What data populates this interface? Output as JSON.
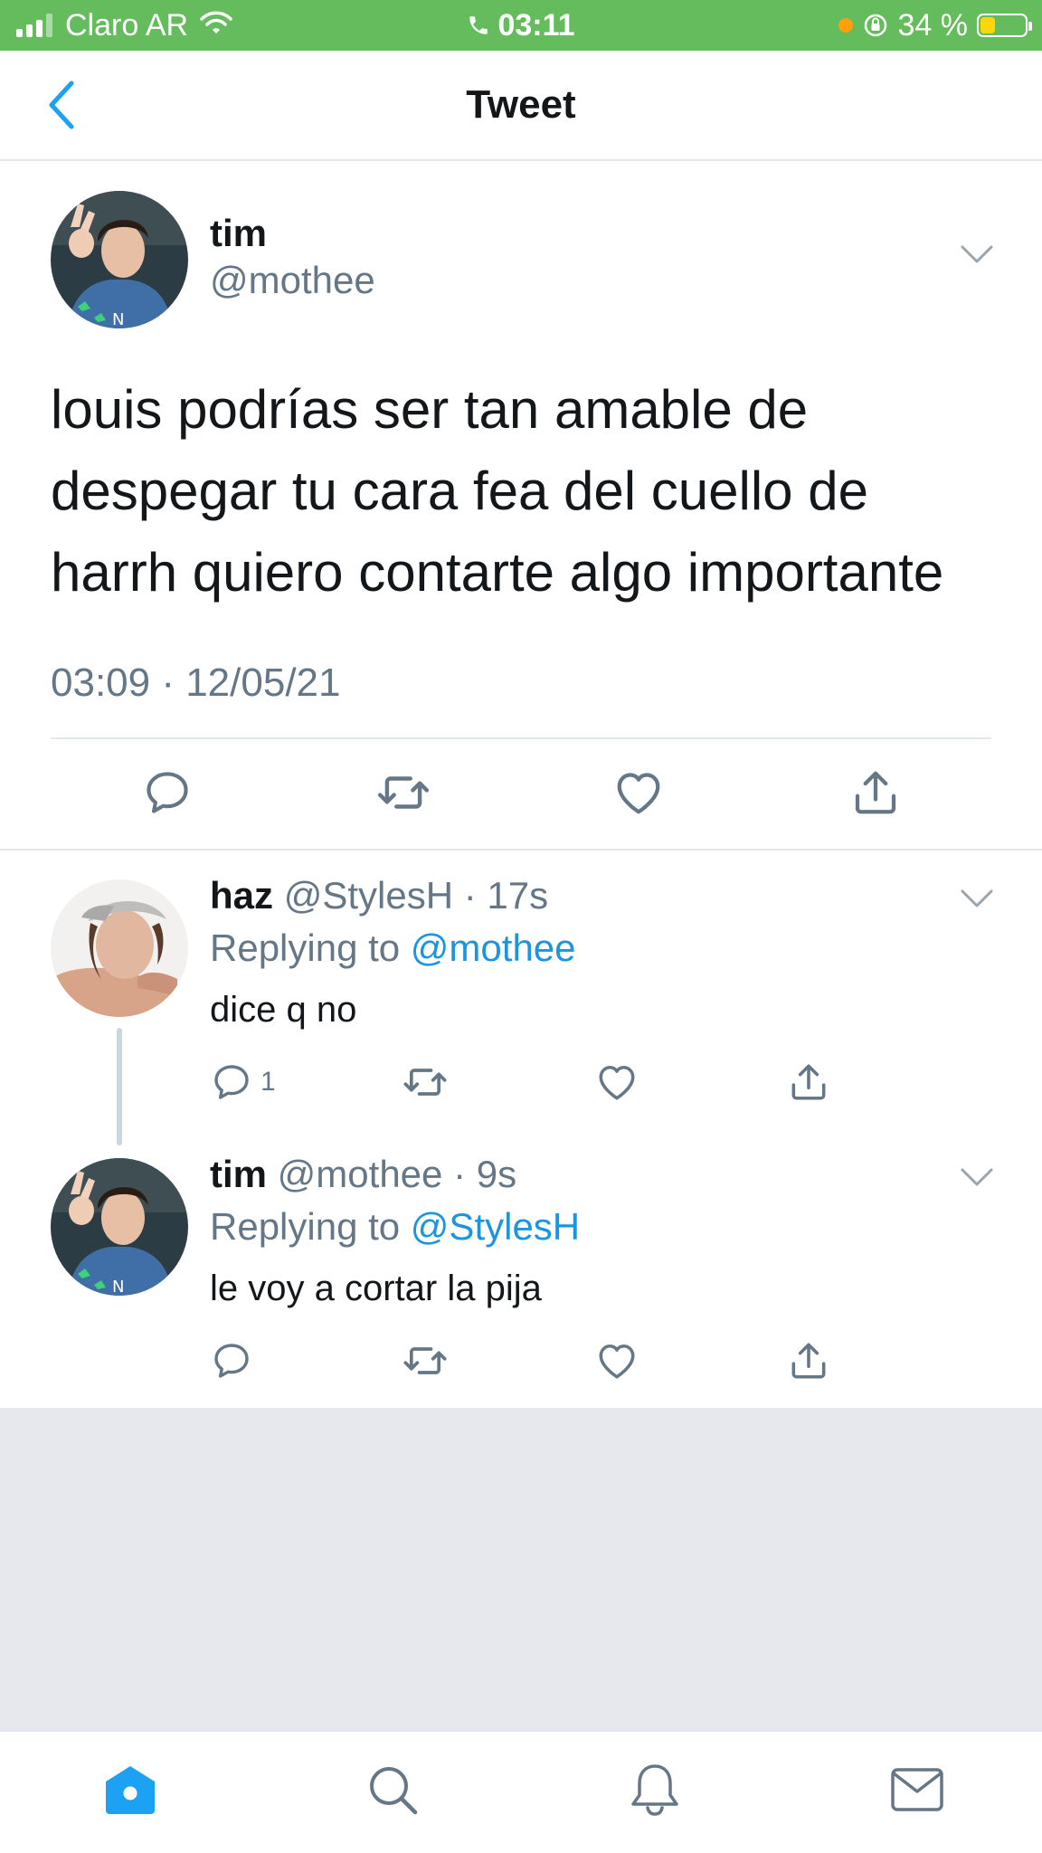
{
  "status_bar": {
    "carrier": "Claro AR",
    "time": "03:11",
    "battery": "34 %",
    "battery_level": 0.34
  },
  "nav": {
    "title": "Tweet"
  },
  "main_tweet": {
    "name": "tim",
    "handle": "@mothee",
    "text": "louis podrías ser tan amable de despegar tu cara fea del cuello de harrh quiero contarte algo importante",
    "timestamp": "03:09 · 12/05/21"
  },
  "replies": [
    {
      "name": "haz",
      "meta": "@StylesH · 17s",
      "replying_prefix": "Replying to ",
      "replying_to": "@mothee",
      "text": "dice q no",
      "reply_count": "1"
    },
    {
      "name": "tim",
      "meta": "@mothee · 9s",
      "replying_prefix": "Replying to ",
      "replying_to": "@StylesH",
      "text": "le voy a cortar la pija",
      "reply_count": ""
    }
  ],
  "colors": {
    "status_bar": "#64bc5c",
    "accent": "#1da1f2",
    "mention": "#1b95e0",
    "secondary_text": "#657786",
    "empty_area": "#e6e8ee"
  },
  "icons": {
    "back": "chevron-left-icon",
    "caret": "chevron-down-icon",
    "reply": "reply-icon",
    "retweet": "retweet-icon",
    "like": "heart-icon",
    "share": "share-icon",
    "tab_home": "home-icon",
    "tab_search": "search-icon",
    "tab_notifications": "bell-icon",
    "tab_messages": "mail-icon"
  }
}
